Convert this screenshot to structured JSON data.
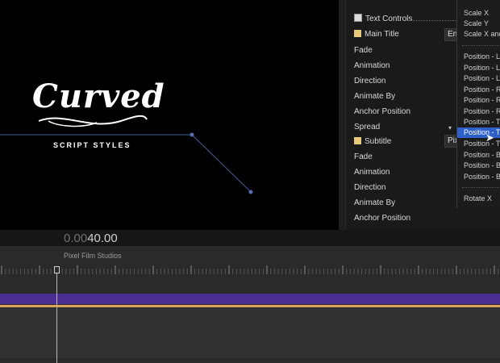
{
  "viewer": {
    "title": "Curved",
    "subtitle": "SCRIPT STYLES"
  },
  "inspector": {
    "text_controls": "Text Controls",
    "main_title": "Main Title",
    "main_title_value": "En",
    "fade1": "Fade",
    "animation1": "Animation",
    "direction1": "Direction",
    "animate_by1": "Animate By",
    "anchor1": "Anchor Position",
    "spread": "Spread",
    "subtitle": "Subtitle",
    "subtitle_value": "Pix",
    "fade2": "Fade",
    "animation2": "Animation",
    "direction2": "Direction",
    "animate_by2": "Animate By",
    "anchor2": "Anchor Position"
  },
  "menu": {
    "items": [
      "Scale X",
      "Scale Y",
      "Scale X and",
      "Position - L",
      "Position - L",
      "Position - L",
      "Position - R",
      "Position - R",
      "Position - R",
      "Position - T",
      "Position - T",
      "Position - T",
      "Position - B",
      "Position - B",
      "Position - B",
      "Rotate X"
    ],
    "selected_index": 10
  },
  "timecode": {
    "dim": "0.00",
    "bright": "40.00"
  },
  "timeline": {
    "label": "Pixel Film Studios"
  },
  "colors": {
    "accent": "#2f5fc9",
    "track": "#4a2e92",
    "audio_line": "#d9a55a"
  }
}
